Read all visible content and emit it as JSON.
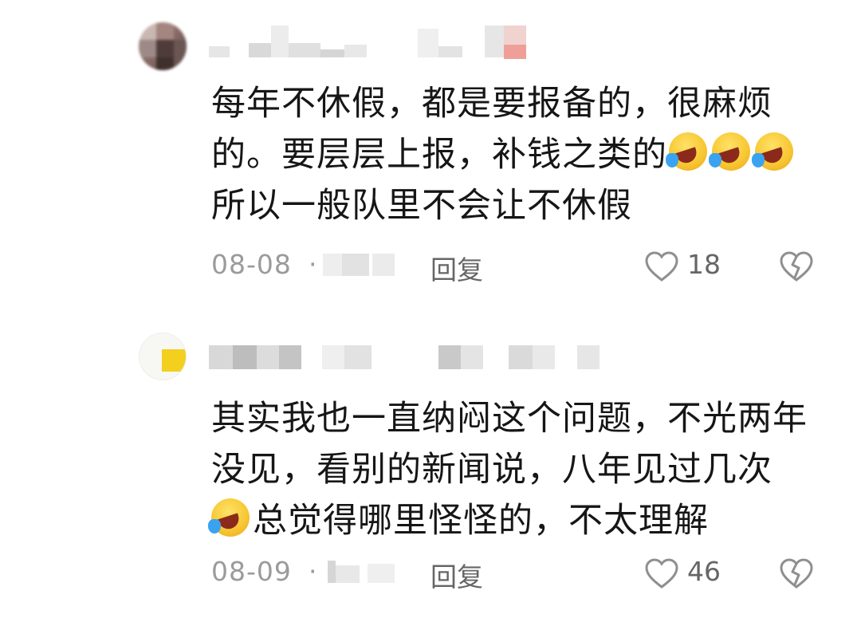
{
  "comments": [
    {
      "text_lines": [
        "每年不休假，都是要报备的，很麻烦",
        "的。要层层上报，补钱之类的",
        "所以一般队里不会让不休假"
      ],
      "emoji": "laughing-crying-emoji",
      "date": "08-08",
      "separator": "·",
      "reply_label": "回复",
      "likes": "18",
      "icons": {
        "like": "heart-outline-icon",
        "dislike": "broken-heart-icon"
      }
    },
    {
      "text_lines": [
        "其实我也一直纳闷这个问题，不光两年",
        "没见，看别的新闻说，八年见过几次",
        "总觉得哪里怪怪的，不太理解"
      ],
      "emoji": "laughing-crying-emoji",
      "date": "08-09",
      "separator": "·",
      "reply_label": "回复",
      "likes": "46",
      "icons": {
        "like": "heart-outline-icon",
        "dislike": "broken-heart-icon"
      }
    }
  ],
  "colors": {
    "text": "#161616",
    "meta": "#9b9b9b",
    "background": "#ffffff",
    "emoji_yellow": "#f7c531"
  }
}
